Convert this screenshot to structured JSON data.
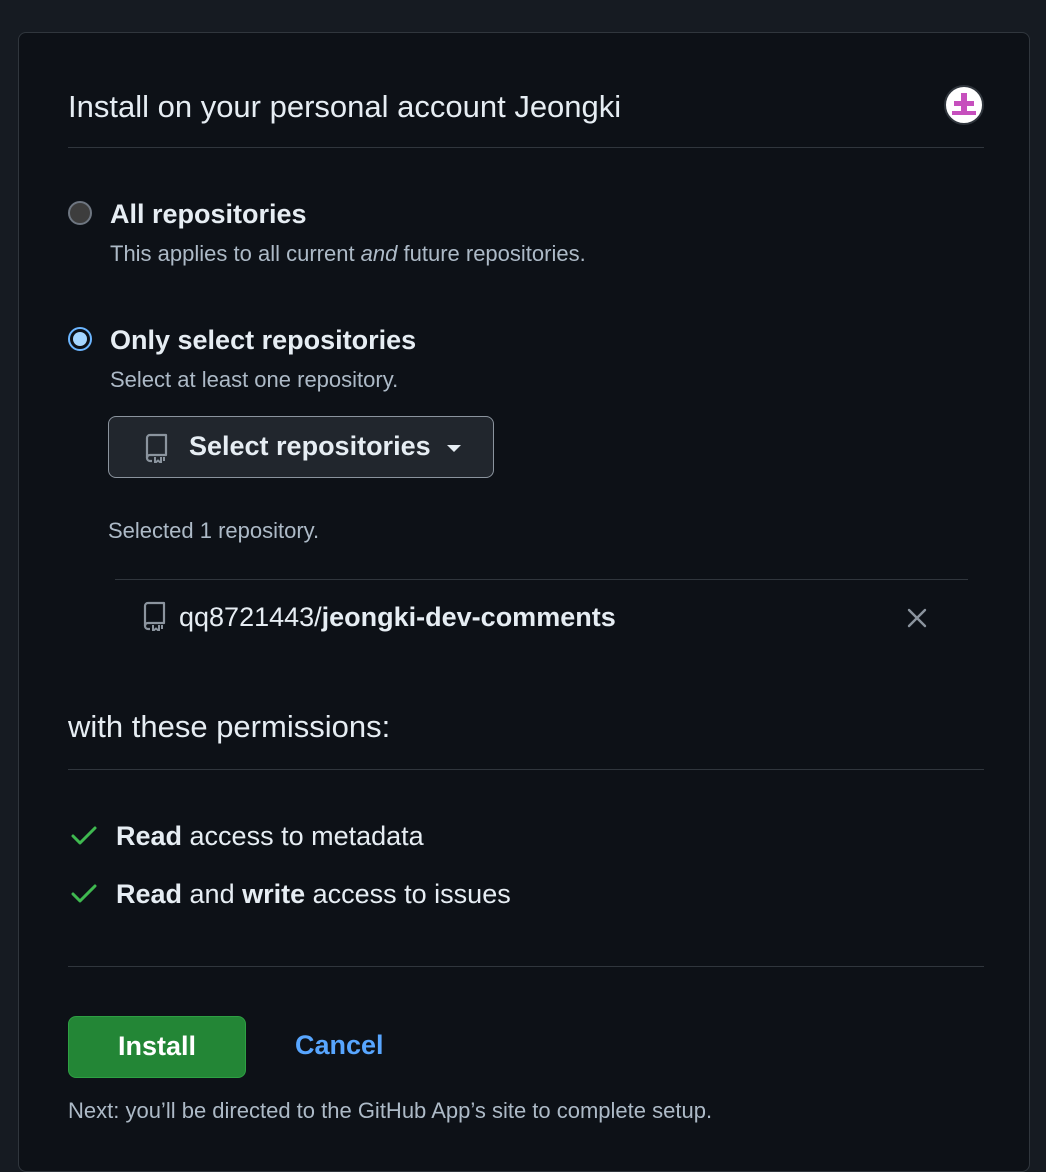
{
  "header": {
    "title": "Install on your personal account Jeongki",
    "avatar_icon": "user-avatar-identicon"
  },
  "repository_access": {
    "all": {
      "label": "All repositories",
      "note_before": "This applies to all current ",
      "note_emphasis": "and",
      "note_after": " future repositories.",
      "selected": false
    },
    "select": {
      "label": "Only select repositories",
      "note": "Select at least one repository.",
      "selected": true
    },
    "select_button_label": "Select repositories",
    "selected_count": "Selected 1 repository.",
    "repos": [
      {
        "owner": "qq8721443/",
        "name": "jeongki-dev-comments"
      }
    ]
  },
  "permissions": {
    "header": "with these permissions:",
    "items": [
      {
        "bold1": "Read",
        "text1": " access to metadata",
        "bold2": "",
        "text2": ""
      },
      {
        "bold1": "Read",
        "text1": " and ",
        "bold2": "write",
        "text2": " access to issues"
      }
    ]
  },
  "actions": {
    "install_label": "Install",
    "cancel_label": "Cancel",
    "next_note": "Next: you’ll be directed to the GitHub App’s site to complete setup."
  },
  "colors": {
    "background": "#0d1117",
    "border": "#30363d",
    "accent_link": "#58a6ff",
    "install_green": "#238636",
    "check_green": "#3fb950"
  }
}
